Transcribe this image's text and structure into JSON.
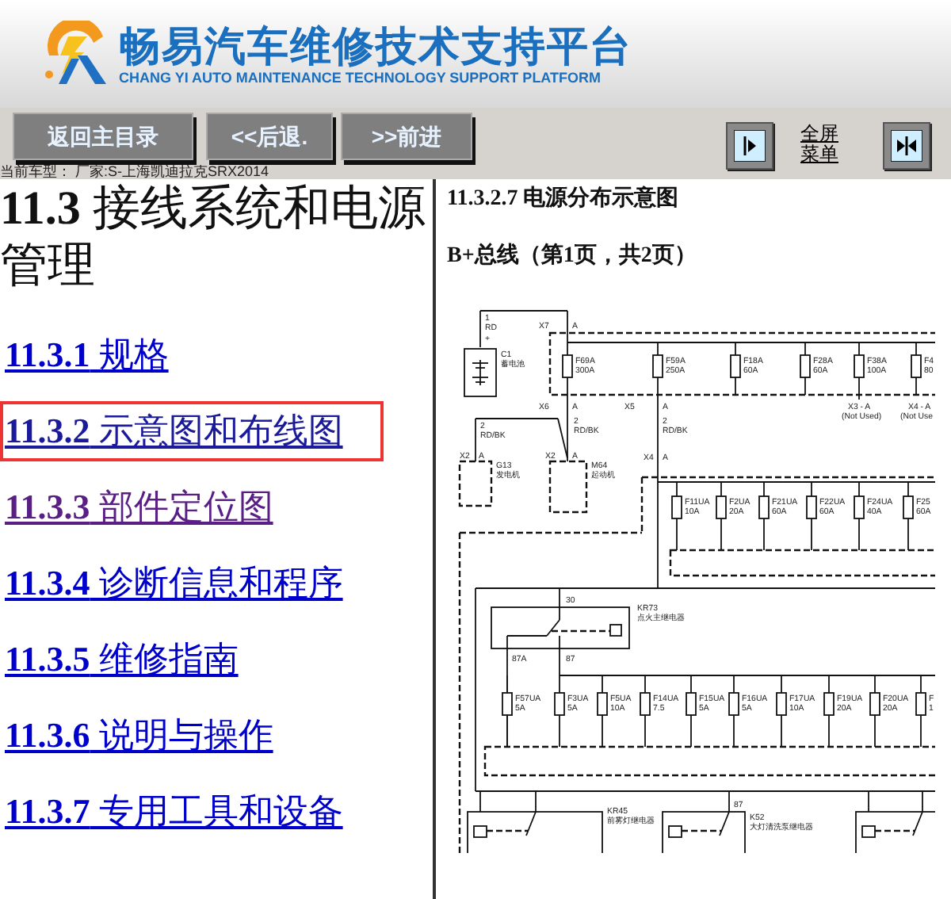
{
  "header": {
    "title": "畅易汽车维修技术支持平台",
    "subtitle": "CHANG YI AUTO MAINTENANCE TECHNOLOGY SUPPORT PLATFORM"
  },
  "toolbar": {
    "buttons": [
      "返回主目录",
      "<<后退.",
      ">>前进"
    ],
    "fullscreen_link": "全屏菜单"
  },
  "vehicle_info": "当前车型：  厂家:S-上海凯迪拉克SRX2014",
  "toc": {
    "title": "**11.3** 接线系统和电源管理",
    "items": [
      {
        "number": "11.3.1",
        "label": "规格",
        "selected": false,
        "visited": false
      },
      {
        "number": "11.3.2",
        "label": "示意图和布线图",
        "selected": true,
        "visited": false
      },
      {
        "number": "11.3.3",
        "label": "部件定位图",
        "selected": false,
        "visited": true
      },
      {
        "number": "11.3.4",
        "label": "诊断信息和程序",
        "selected": false,
        "visited": false
      },
      {
        "number": "11.3.5",
        "label": "维修指南",
        "selected": false,
        "visited": false
      },
      {
        "number": "11.3.6",
        "label": "说明与操作",
        "selected": false,
        "visited": false
      },
      {
        "number": "11.3.7",
        "label": "专用工具和设备",
        "selected": false,
        "visited": false
      }
    ]
  },
  "content": {
    "heading": "11.3.2.7 电源分布示意图",
    "subtitle": "B+总线（第1页，共2页）",
    "diagram": {
      "battery": {
        "pin": "1",
        "wire": "RD",
        "sign": "+",
        "ref": "C1",
        "name": "蓄电池"
      },
      "bus_input": {
        "ref": "X7",
        "pin": "A"
      },
      "top_fuses": [
        {
          "name": "F69A",
          "rating": "300A"
        },
        {
          "name": "F59A",
          "rating": "250A"
        },
        {
          "name": "F18A",
          "rating": "60A"
        },
        {
          "name": "F28A",
          "rating": "60A"
        },
        {
          "name": "F38A",
          "rating": "100A"
        },
        {
          "name": "F4",
          "rating": "80"
        }
      ],
      "top_outputs": [
        {
          "ref": "X6",
          "pin": "A"
        },
        {
          "ref": "X5",
          "pin": "A"
        }
      ],
      "unused_outputs": [
        {
          "ref": "X3 - A",
          "note": "(Not Used)"
        },
        {
          "ref": "X4 - A",
          "note": "(Not Use"
        }
      ],
      "wires": [
        {
          "pin": "2",
          "code": "RD/BK"
        },
        {
          "pin": "2",
          "code": "RD/BK"
        },
        {
          "pin": "2",
          "code": "RD/BK"
        }
      ],
      "generator": {
        "connector": "X2",
        "pin": "A",
        "ref": "G13",
        "name": "发电机"
      },
      "starter": {
        "connector": "X2",
        "pin": "A",
        "ref": "M64",
        "name": "起动机"
      },
      "mid_input": {
        "ref": "X4",
        "pin": "A"
      },
      "mid_fuses": [
        {
          "name": "F11UA",
          "rating": "10A"
        },
        {
          "name": "F2UA",
          "rating": "20A"
        },
        {
          "name": "F21UA",
          "rating": "60A"
        },
        {
          "name": "F22UA",
          "rating": "60A"
        },
        {
          "name": "F24UA",
          "rating": "40A"
        },
        {
          "name": "F25",
          "rating": "60A"
        }
      ],
      "ignition_relay": {
        "ref": "KR73",
        "name": "点火主继电器",
        "pins": [
          "30",
          "87A",
          "87"
        ]
      },
      "low_fuses": [
        {
          "name": "F57UA",
          "rating": "5A"
        },
        {
          "name": "F3UA",
          "rating": "5A"
        },
        {
          "name": "F5UA",
          "rating": "10A"
        },
        {
          "name": "F14UA",
          "rating": "7.5"
        },
        {
          "name": "F15UA",
          "rating": "5A"
        },
        {
          "name": "F16UA",
          "rating": "5A"
        },
        {
          "name": "F17UA",
          "rating": "10A"
        },
        {
          "name": "F19UA",
          "rating": "20A"
        },
        {
          "name": "F20UA",
          "rating": "20A"
        },
        {
          "name": "F",
          "rating": "1"
        }
      ],
      "relays": [
        {
          "ref": "KR45",
          "name": "前雾灯继电器"
        },
        {
          "ref": "K52",
          "name": "大灯清洗泵继电器",
          "pin": "87"
        }
      ]
    }
  }
}
